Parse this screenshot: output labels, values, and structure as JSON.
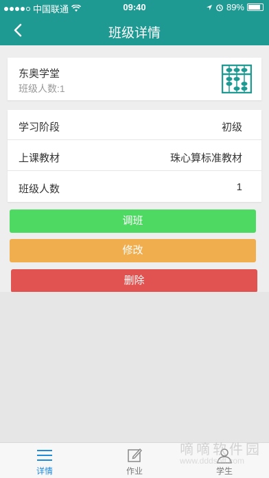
{
  "status_bar": {
    "carrier": "中国联通",
    "time": "09:40",
    "battery": "89%"
  },
  "nav": {
    "title": "班级详情",
    "back_icon": "chevron-left-icon"
  },
  "class_card": {
    "name": "东奥学堂",
    "count_text": "班级人数:1",
    "icon": "abacus-icon"
  },
  "info": {
    "rows": [
      {
        "label": "学习阶段",
        "value": "初级"
      },
      {
        "label": "上课教材",
        "value": "珠心算标准教材"
      },
      {
        "label": "班级人数",
        "value": "1"
      }
    ]
  },
  "buttons": {
    "transfer": "调班",
    "edit": "修改",
    "delete": "删除"
  },
  "tabs": [
    {
      "label": "详情",
      "icon": "list-icon",
      "active": true
    },
    {
      "label": "作业",
      "icon": "edit-icon",
      "active": false
    },
    {
      "label": "学生",
      "icon": "person-icon",
      "active": false
    }
  ],
  "watermark": {
    "text": "嘀嘀软件园",
    "url": "www.dddsoft.com"
  },
  "colors": {
    "primary": "#1f9a93",
    "green": "#4ed963",
    "orange": "#f0ae4e",
    "red": "#e05350",
    "tab_active": "#1f8ad8"
  }
}
